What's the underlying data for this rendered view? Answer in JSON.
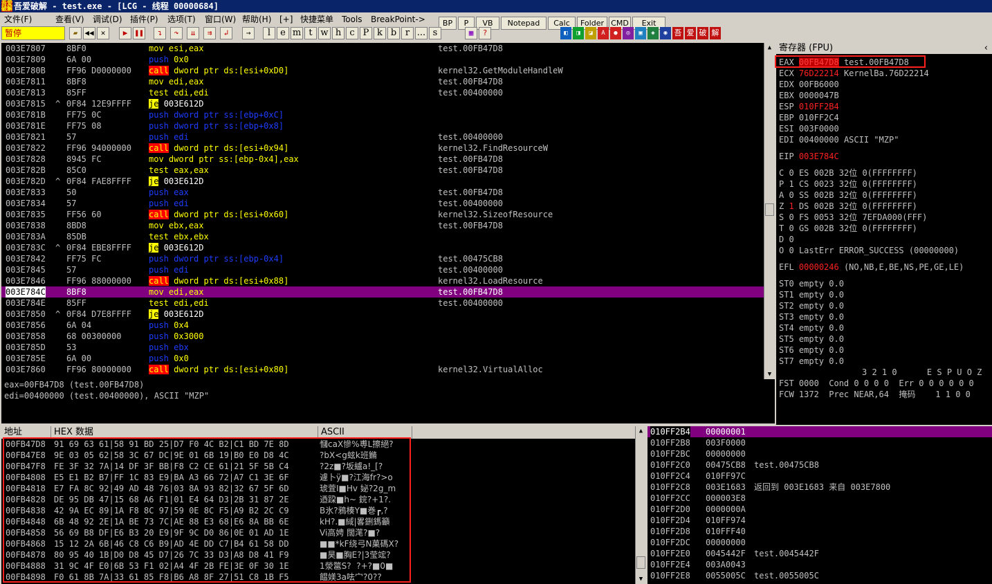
{
  "window": {
    "title": "吾爱破解 - test.exe - [LCG - 线程 00000684]"
  },
  "menu": [
    "文件(F)",
    "查看(V)",
    "调试(D)",
    "插件(P)",
    "选项(T)",
    "窗口(W)",
    "帮助(H)",
    "[+]",
    "快捷菜单",
    "Tools",
    "BreakPoint->"
  ],
  "quick_buttons": [
    "BP",
    "P",
    "VB",
    "Notepad",
    "Calc",
    "Folder",
    "CMD",
    "Exit"
  ],
  "status": {
    "paused": "暂停"
  },
  "toolbar": {
    "letters": [
      "l",
      "e",
      "m",
      "t",
      "w",
      "h",
      "c",
      "P",
      "k",
      "b",
      "r",
      "...",
      "s"
    ],
    "right_labels": [
      "吾",
      "爱",
      "破",
      "解"
    ]
  },
  "cpu_rows": [
    {
      "addr": "003E7807",
      "mark": "",
      "hex": "8BF0",
      "op": "mov",
      "args": "esi,eax",
      "cmt": "test.00FB47D8"
    },
    {
      "addr": "003E7809",
      "mark": "",
      "hex": "6A 00",
      "op": "push",
      "args": "0x0",
      "cmt": ""
    },
    {
      "addr": "003E780B",
      "mark": "",
      "hex": "FF96 D0000000",
      "op": "call",
      "args": "dword ptr ds:[esi+0xD0]",
      "cmt": "kernel32.GetModuleHandleW"
    },
    {
      "addr": "003E7811",
      "mark": "",
      "hex": "8BF8",
      "op": "mov",
      "args": "edi,eax",
      "cmt": "test.00FB47D8"
    },
    {
      "addr": "003E7813",
      "mark": "",
      "hex": "85FF",
      "op": "test",
      "args": "edi,edi",
      "cmt": "test.00400000"
    },
    {
      "addr": "003E7815",
      "mark": "^",
      "hex": "0F84 12E9FFFF",
      "op": "je",
      "args": "003E612D",
      "cmt": ""
    },
    {
      "addr": "003E781B",
      "mark": "",
      "hex": "FF75 0C",
      "op": "push",
      "args": "dword ptr ss:[ebp+0xC]",
      "cmt": ""
    },
    {
      "addr": "003E781E",
      "mark": "",
      "hex": "FF75 08",
      "op": "push",
      "args": "dword ptr ss:[ebp+0x8]",
      "cmt": ""
    },
    {
      "addr": "003E7821",
      "mark": "",
      "hex": "57",
      "op": "push",
      "args": "edi",
      "cmt": "test.00400000"
    },
    {
      "addr": "003E7822",
      "mark": "",
      "hex": "FF96 94000000",
      "op": "call",
      "args": "dword ptr ds:[esi+0x94]",
      "cmt": "kernel32.FindResourceW"
    },
    {
      "addr": "003E7828",
      "mark": "",
      "hex": "8945 FC",
      "op": "mov",
      "args": "dword ptr ss:[ebp-0x4],eax",
      "cmt": "test.00FB47D8"
    },
    {
      "addr": "003E782B",
      "mark": "",
      "hex": "85C0",
      "op": "test",
      "args": "eax,eax",
      "cmt": "test.00FB47D8"
    },
    {
      "addr": "003E782D",
      "mark": "^",
      "hex": "0F84 FAE8FFFF",
      "op": "je",
      "args": "003E612D",
      "cmt": ""
    },
    {
      "addr": "003E7833",
      "mark": "",
      "hex": "50",
      "op": "push",
      "args": "eax",
      "cmt": "test.00FB47D8"
    },
    {
      "addr": "003E7834",
      "mark": "",
      "hex": "57",
      "op": "push",
      "args": "edi",
      "cmt": "test.00400000"
    },
    {
      "addr": "003E7835",
      "mark": "",
      "hex": "FF56 60",
      "op": "call",
      "args": "dword ptr ds:[esi+0x60]",
      "cmt": "kernel32.SizeofResource"
    },
    {
      "addr": "003E7838",
      "mark": "",
      "hex": "8BD8",
      "op": "mov",
      "args": "ebx,eax",
      "cmt": "test.00FB47D8"
    },
    {
      "addr": "003E783A",
      "mark": "",
      "hex": "85DB",
      "op": "test",
      "args": "ebx,ebx",
      "cmt": ""
    },
    {
      "addr": "003E783C",
      "mark": "^",
      "hex": "0F84 EBE8FFFF",
      "op": "je",
      "args": "003E612D",
      "cmt": ""
    },
    {
      "addr": "003E7842",
      "mark": "",
      "hex": "FF75 FC",
      "op": "push",
      "args": "dword ptr ss:[ebp-0x4]",
      "cmt": "test.00475CB8"
    },
    {
      "addr": "003E7845",
      "mark": "",
      "hex": "57",
      "op": "push",
      "args": "edi",
      "cmt": "test.00400000"
    },
    {
      "addr": "003E7846",
      "mark": "",
      "hex": "FF96 88000000",
      "op": "call",
      "args": "dword ptr ds:[esi+0x88]",
      "cmt": "kernel32.LoadResource"
    },
    {
      "addr": "003E784C",
      "mark": "",
      "hex": "8BF8",
      "op": "mov",
      "args": "edi,eax",
      "cmt": "test.00FB47D8",
      "sel": true
    },
    {
      "addr": "003E784E",
      "mark": "",
      "hex": "85FF",
      "op": "test",
      "args": "edi,edi",
      "cmt": "test.00400000"
    },
    {
      "addr": "003E7850",
      "mark": "^",
      "hex": "0F84 D7E8FFFF",
      "op": "je",
      "args": "003E612D",
      "cmt": ""
    },
    {
      "addr": "003E7856",
      "mark": "",
      "hex": "6A 04",
      "op": "push",
      "args": "0x4",
      "cmt": ""
    },
    {
      "addr": "003E7858",
      "mark": "",
      "hex": "68 00300000",
      "op": "push",
      "args": "0x3000",
      "cmt": ""
    },
    {
      "addr": "003E785D",
      "mark": "",
      "hex": "53",
      "op": "push",
      "args": "ebx",
      "cmt": ""
    },
    {
      "addr": "003E785E",
      "mark": "",
      "hex": "6A 00",
      "op": "push",
      "args": "0x0",
      "cmt": ""
    },
    {
      "addr": "003E7860",
      "mark": "",
      "hex": "FF96 80000000",
      "op": "call",
      "args": "dword ptr ds:[esi+0x80]",
      "cmt": "kernel32.VirtualAlloc"
    }
  ],
  "info": [
    "eax=00FB47D8 (test.00FB47D8)",
    "edi=00400000 (test.00400000), ASCII \"MZP\""
  ],
  "registers": {
    "header": "寄存器 (FPU)",
    "gp": [
      {
        "n": "EAX",
        "v": "00FB47D8",
        "c": "test.00FB47D8",
        "red": true
      },
      {
        "n": "ECX",
        "v": "76D22214",
        "c": "KernelBa.76D22214",
        "red": true
      },
      {
        "n": "EDX",
        "v": "00FB6000",
        "c": ""
      },
      {
        "n": "EBX",
        "v": "0000047B",
        "c": ""
      },
      {
        "n": "ESP",
        "v": "010FF2B4",
        "c": "",
        "red": true
      },
      {
        "n": "EBP",
        "v": "010FF2C4",
        "c": ""
      },
      {
        "n": "ESI",
        "v": "003F0000",
        "c": ""
      },
      {
        "n": "EDI",
        "v": "00400000",
        "c": "ASCII \"MZP\""
      }
    ],
    "eip": {
      "n": "EIP",
      "v": "003E784C"
    },
    "flags": [
      {
        "f": "C",
        "b": "0",
        "seg": "ES 002B",
        "w": "32位",
        "d": "0(FFFFFFFF)"
      },
      {
        "f": "P",
        "b": "1",
        "seg": "CS 0023",
        "w": "32位",
        "d": "0(FFFFFFFF)"
      },
      {
        "f": "A",
        "b": "0",
        "seg": "SS 002B",
        "w": "32位",
        "d": "0(FFFFFFFF)"
      },
      {
        "f": "Z",
        "b": "1",
        "seg": "DS 002B",
        "w": "32位",
        "d": "0(FFFFFFFF)",
        "red": true
      },
      {
        "f": "S",
        "b": "0",
        "seg": "FS 0053",
        "w": "32位",
        "d": "7EFDA000(FFF)"
      },
      {
        "f": "T",
        "b": "0",
        "seg": "GS 002B",
        "w": "32位",
        "d": "0(FFFFFFFF)"
      },
      {
        "f": "D",
        "b": "0",
        "seg": "",
        "w": "",
        "d": ""
      },
      {
        "f": "O",
        "b": "0",
        "seg": "LastErr ERROR_SUCCESS (00000000)",
        "w": "",
        "d": ""
      }
    ],
    "efl": {
      "n": "EFL",
      "v": "00000246",
      "c": "(NO,NB,E,BE,NS,PE,GE,LE)"
    },
    "fpu": [
      "ST0 empty 0.0",
      "ST1 empty 0.0",
      "ST2 empty 0.0",
      "ST3 empty 0.0",
      "ST4 empty 0.0",
      "ST5 empty 0.0",
      "ST6 empty 0.0",
      "ST7 empty 0.0"
    ],
    "fpu_bits_hdr": "3 2 1 0      E S P U O Z",
    "fst": "FST 0000  Cond 0 0 0 0  Err 0 0 0 0 0 0",
    "fcw": "FCW 1372  Prec NEAR,64  掩码    1 1 0 0"
  },
  "dump": {
    "headers": [
      "地址",
      "HEX 数据",
      "ASCII"
    ],
    "rows": [
      {
        "a": "00FB47D8",
        "h": "91 69 63 61|58 91 BD 25|D7 F0 4C B2|C1 BD 7E 8D",
        "s": "慖caX慘%尃L擦絕?"
      },
      {
        "a": "00FB47E8",
        "h": "9E 03 05 62|58 3C 67 DC|9E 01 6B 19|B0 E0 D8 4C",
        "s": "?\u0003bX<g蚿k\u0019班鏅"
      },
      {
        "a": "00FB47F8",
        "h": "FE 3F 32 7A|14 DF 3F BB|F8 C2 CE 61|21 5F 5B C4",
        "s": "?2z■?坂纑a!_[?"
      },
      {
        "a": "00FB4808",
        "h": "E5 E1 B2 B7|FF 1C 83 E9|BA A3 66 72|A7 C1 3E 6F",
        "s": "遽卜ÿ■?江海fr?>o"
      },
      {
        "a": "00FB4818",
        "h": "E7 FA 8C 92|49 AD 48 76|03 8A 93 82|32 67 5F 6D",
        "s": "琥萓I■Hv 妼?2g_m"
      },
      {
        "a": "00FB4828",
        "h": "DE 95 DB 47|15 68 A6 F1|01 E4 64 D3|2B 31 87 2E",
        "s": "迺跥■h~ 鋎?+1?."
      },
      {
        "a": "00FB4838",
        "h": "42 9A EC 89|1A F8 8C 97|59 0E 8C F5|A9 B2 2C C9",
        "s": "B氷?鴉楱Y■巻┏,?"
      },
      {
        "a": "00FB4848",
        "h": "6B 48 92 2E|1A BE 73 7C|AE 88 E3 68|E6 8A BB 6E",
        "s": "kH?.■緎|畧鉶鎷籲"
      },
      {
        "a": "00FB4858",
        "h": "56 69 B8 DF|E6 B3 20 E9|9F 9C D0 86|0E 01 AD 1E",
        "s": "Vi高娉 闊滗?■?"
      },
      {
        "a": "00FB4868",
        "h": "15 12 2A 6B|46 C8 C6 B9|AD 4E DD C7|B4 61 58 DD",
        "s": "■■*kF绕弓N菓碼X?"
      },
      {
        "a": "00FB4878",
        "h": "80 95 40 1B|D0 D8 45 D7|26 7C 33 D3|A8 D8 41 F9",
        "s": "■昊■胸E?|3莹竤?"
      },
      {
        "a": "00FB4888",
        "h": "31 9C 4F E0|6B 53 F1 02|A4 4F 2B FE|3E 0F 30 1E",
        "s": "1滎鄨S?  ?+?■0■"
      },
      {
        "a": "00FB4898",
        "h": "F0 61 8B 7A|33 61 85 F8|B6 A8 8F 27|51 C8 1B F5",
        "s": "饂媄3a呿宀?0??"
      }
    ]
  },
  "stack": [
    {
      "a": "010FF2B4",
      "v": "00000001",
      "c": "",
      "sel": true
    },
    {
      "a": "010FF2B8",
      "v": "003F0000",
      "c": ""
    },
    {
      "a": "010FF2BC",
      "v": "00000000",
      "c": ""
    },
    {
      "a": "010FF2C0",
      "v": "00475CB8",
      "c": "test.00475CB8"
    },
    {
      "a": "010FF2C4",
      "v": "010FF97C",
      "c": ""
    },
    {
      "a": "010FF2C8",
      "v": "003E1683",
      "c": "返回到 003E1683 来自 003E7800"
    },
    {
      "a": "010FF2CC",
      "v": "000003E8",
      "c": ""
    },
    {
      "a": "010FF2D0",
      "v": "0000000A",
      "c": ""
    },
    {
      "a": "010FF2D4",
      "v": "010FF974",
      "c": ""
    },
    {
      "a": "010FF2D8",
      "v": "010FFF40",
      "c": ""
    },
    {
      "a": "010FF2DC",
      "v": "00000000",
      "c": ""
    },
    {
      "a": "010FF2E0",
      "v": "0045442F",
      "c": "test.0045442F"
    },
    {
      "a": "010FF2E4",
      "v": "003A0043",
      "c": ""
    },
    {
      "a": "010FF2E8",
      "v": "0055005C",
      "c": "test.0055005C"
    }
  ]
}
